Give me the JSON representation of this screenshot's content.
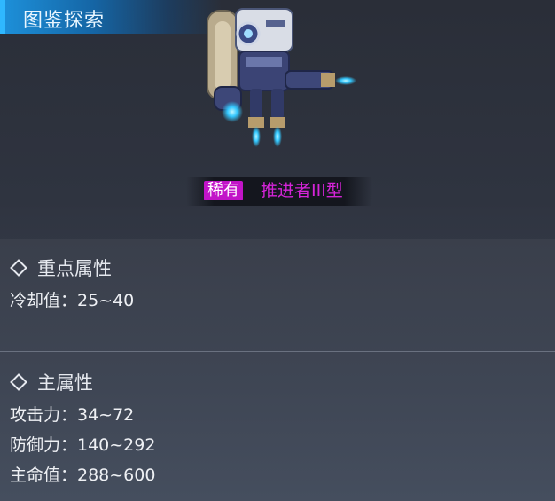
{
  "header": {
    "title": "图鉴探索"
  },
  "item": {
    "rarity": "稀有",
    "name": "推进者III型",
    "colors": {
      "rarity_badge": "#c214c8",
      "name": "#d524d8"
    },
    "art": "robot-thruster-mech"
  },
  "sections": {
    "key_attributes": {
      "title": "重点属性",
      "stats": [
        {
          "text": "冷却值：25~40"
        }
      ]
    },
    "main_attributes": {
      "title": "主属性",
      "stats": [
        {
          "text": "攻击力：34~72"
        },
        {
          "text": "防御力：140~292"
        },
        {
          "text": "主命值：288~600"
        }
      ]
    }
  },
  "colors": {
    "header_accent": "#1d8fd8",
    "background": "#2f3440"
  }
}
